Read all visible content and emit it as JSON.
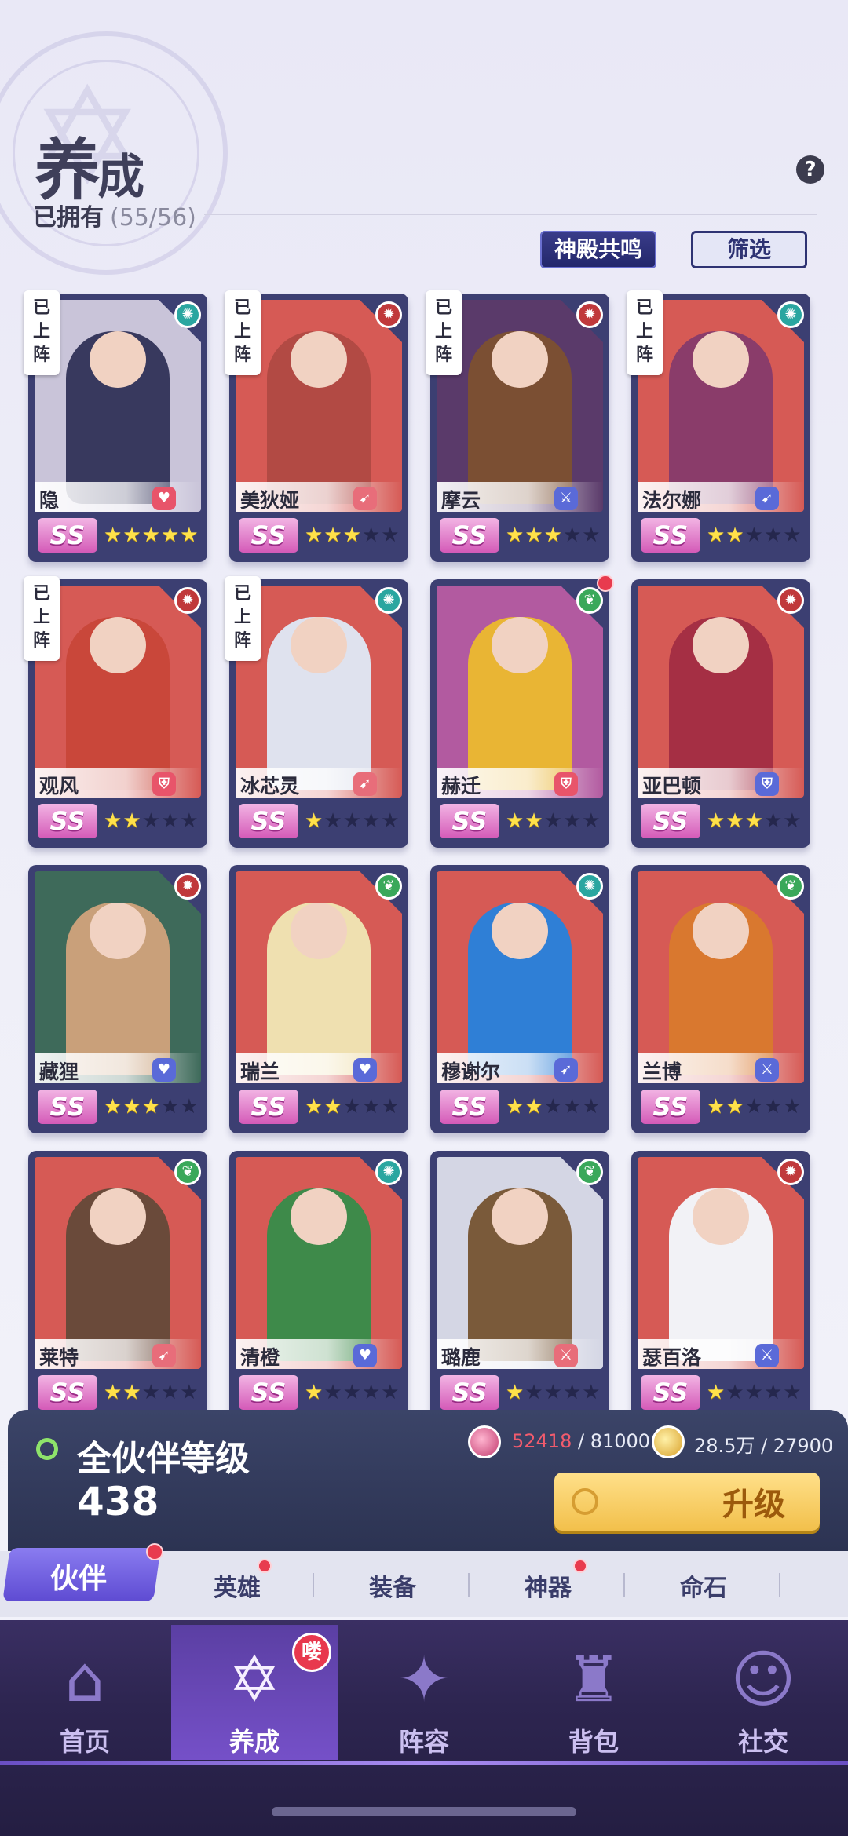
{
  "header": {
    "title_big": "养",
    "title_small": "成",
    "owned_label": "已拥有",
    "owned_count": "(55/56)",
    "help": "?",
    "temple_button": "神殿共鸣",
    "filter_button": "筛选"
  },
  "deployed_tag": "已上阵",
  "companions": [
    {
      "name": "隐",
      "rank": "SS",
      "stars": 5,
      "role_icon": "heart-icon",
      "role_color": "#e8546a",
      "element_color": "#2aa6a0",
      "element_icon": "swirl-icon",
      "art_color": "#c9c4d9",
      "art_fig": "#38395e",
      "deployed": true
    },
    {
      "name": "美狄娅",
      "rank": "SS",
      "stars": 3,
      "role_icon": "bow-icon",
      "role_color": "#e86d7a",
      "element_color": "#c0393b",
      "element_icon": "flame-icon",
      "art_color": "#d65a55",
      "art_fig": "#b24a44",
      "deployed": true
    },
    {
      "name": "摩云",
      "rank": "SS",
      "stars": 3,
      "role_icon": "sword-icon",
      "role_color": "#5a6ad8",
      "element_color": "#c0393b",
      "element_icon": "flame-icon",
      "art_color": "#5a3a6a",
      "art_fig": "#7b4f33",
      "deployed": true
    },
    {
      "name": "法尔娜",
      "rank": "SS",
      "stars": 2,
      "role_icon": "bow-icon",
      "role_color": "#5a6ad8",
      "element_color": "#2aa6a0",
      "element_icon": "swirl-icon",
      "art_color": "#d65a55",
      "art_fig": "#8a3c6a",
      "deployed": true
    },
    {
      "name": "观风",
      "rank": "SS",
      "stars": 2,
      "role_icon": "shield-icon",
      "role_color": "#e8546a",
      "element_color": "#c0393b",
      "element_icon": "flame-icon",
      "art_color": "#d65a55",
      "art_fig": "#c9473a",
      "deployed": true
    },
    {
      "name": "冰芯灵",
      "rank": "SS",
      "stars": 1,
      "role_icon": "bow-icon",
      "role_color": "#e86d7a",
      "element_color": "#2aa6a0",
      "element_icon": "swirl-icon",
      "art_color": "#d65a55",
      "art_fig": "#dfe2ee",
      "deployed": true
    },
    {
      "name": "赫迁",
      "rank": "SS",
      "stars": 2,
      "role_icon": "shield-icon",
      "role_color": "#e8546a",
      "element_color": "#3aa85a",
      "element_icon": "leaf-icon",
      "art_color": "#b25aa0",
      "art_fig": "#e9b534",
      "deployed": false,
      "red_dot": true
    },
    {
      "name": "亚巴顿",
      "rank": "SS",
      "stars": 3,
      "role_icon": "shield-icon",
      "role_color": "#5a6ad8",
      "element_color": "#c0393b",
      "element_icon": "flame-icon",
      "art_color": "#d65a55",
      "art_fig": "#a52f44",
      "deployed": false
    },
    {
      "name": "藏狸",
      "rank": "SS",
      "stars": 3,
      "role_icon": "heart-icon",
      "role_color": "#5a6ad8",
      "element_color": "#c0393b",
      "element_icon": "flame-icon",
      "art_color": "#3e6a5a",
      "art_fig": "#c9a07a",
      "deployed": false
    },
    {
      "name": "瑞兰",
      "rank": "SS",
      "stars": 2,
      "role_icon": "heart-icon",
      "role_color": "#5a6ad8",
      "element_color": "#3aa85a",
      "element_icon": "leaf-icon",
      "art_color": "#d65a55",
      "art_fig": "#efe0b0",
      "deployed": false
    },
    {
      "name": "穆谢尔",
      "rank": "SS",
      "stars": 2,
      "role_icon": "bow-icon",
      "role_color": "#5a6ad8",
      "element_color": "#2aa6a0",
      "element_icon": "swirl-icon",
      "art_color": "#d65a55",
      "art_fig": "#2f7fd6",
      "deployed": false
    },
    {
      "name": "兰博",
      "rank": "SS",
      "stars": 2,
      "role_icon": "sword-icon",
      "role_color": "#5a6ad8",
      "element_color": "#3aa85a",
      "element_icon": "leaf-icon",
      "art_color": "#d65a55",
      "art_fig": "#d9782f",
      "deployed": false
    },
    {
      "name": "莱特",
      "rank": "SS",
      "stars": 2,
      "role_icon": "bow-icon",
      "role_color": "#e86d7a",
      "element_color": "#3aa85a",
      "element_icon": "leaf-icon",
      "art_color": "#d65a55",
      "art_fig": "#6a4a3a",
      "deployed": false
    },
    {
      "name": "清橙",
      "rank": "SS",
      "stars": 1,
      "role_icon": "heart-icon",
      "role_color": "#5a6ad8",
      "element_color": "#2aa6a0",
      "element_icon": "swirl-icon",
      "art_color": "#d65a55",
      "art_fig": "#3e8a4a",
      "deployed": false
    },
    {
      "name": "璐鹿",
      "rank": "SS",
      "stars": 1,
      "role_icon": "sword-icon",
      "role_color": "#e86d7a",
      "element_color": "#3aa85a",
      "element_icon": "leaf-icon",
      "art_color": "#d4d6e4",
      "art_fig": "#7a5a3a",
      "deployed": false
    },
    {
      "name": "瑟百洛",
      "rank": "SS",
      "stars": 1,
      "role_icon": "sword-icon",
      "role_color": "#5a6ad8",
      "element_color": "#c0393b",
      "element_icon": "flame-icon",
      "art_color": "#d65a55",
      "art_fig": "#f2f2f6",
      "deployed": false
    }
  ],
  "level_panel": {
    "title": "全伙伴等级",
    "level": "438",
    "res1_current": "52418",
    "res1_total": " / 81000",
    "res2": "28.5万 / 27900",
    "upgrade_label": "升级"
  },
  "subtabs": [
    {
      "label": "伙伴",
      "active": true
    },
    {
      "label": "英雄",
      "dot": true
    },
    {
      "label": "装备"
    },
    {
      "label": "神器",
      "dot": true
    },
    {
      "label": "命石"
    }
  ],
  "nav": [
    {
      "label": "首页",
      "icon": "home-icon"
    },
    {
      "label": "养成",
      "icon": "star-emblem-icon",
      "active": true,
      "badge": "喽"
    },
    {
      "label": "阵容",
      "icon": "formation-icon"
    },
    {
      "label": "背包",
      "icon": "bag-icon"
    },
    {
      "label": "社交",
      "icon": "social-icon"
    }
  ]
}
